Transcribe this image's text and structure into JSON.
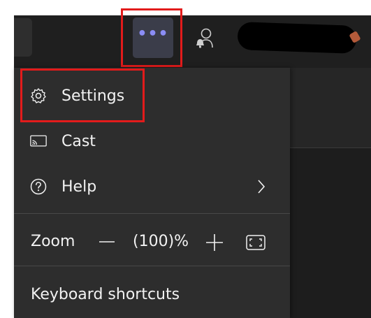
{
  "header": {
    "more_button": {
      "label": "More options",
      "glyph": "•••",
      "color": "#8b8df5"
    },
    "person_icon": "person-notification-icon"
  },
  "menu": {
    "items": [
      {
        "label": "Settings",
        "icon": "gear-icon"
      },
      {
        "label": "Cast",
        "icon": "cast-icon"
      },
      {
        "label": "Help",
        "icon": "help-circle-icon",
        "has_submenu": true
      }
    ],
    "zoom": {
      "label": "Zoom",
      "value": "(100)%",
      "minus_icon": "minus-icon",
      "plus_icon": "plus-icon",
      "fit_icon": "fullscreen-icon"
    },
    "keyboard_shortcuts": "Keyboard shortcuts"
  },
  "colors": {
    "highlight": "#e21b1b",
    "menu_background": "#2d2d2d",
    "titlebar_background": "#1f1f1f"
  }
}
